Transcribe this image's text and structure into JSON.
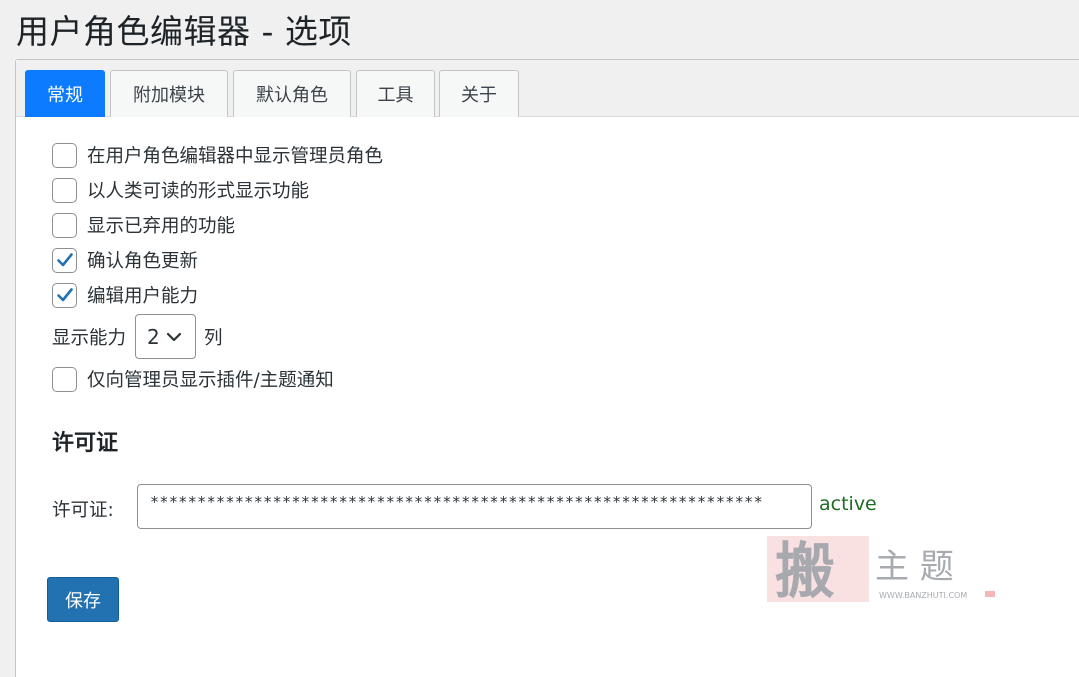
{
  "page": {
    "title": "用户角色编辑器 - 选项"
  },
  "tabs": [
    {
      "label": "常规",
      "active": true
    },
    {
      "label": "附加模块",
      "active": false
    },
    {
      "label": "默认角色",
      "active": false
    },
    {
      "label": "工具",
      "active": false
    },
    {
      "label": "关于",
      "active": false
    }
  ],
  "options": [
    {
      "label": "在用户角色编辑器中显示管理员角色",
      "checked": false
    },
    {
      "label": "以人类可读的形式显示功能",
      "checked": false
    },
    {
      "label": "显示已弃用的功能",
      "checked": false
    },
    {
      "label": "确认角色更新",
      "checked": true
    },
    {
      "label": "编辑用户能力",
      "checked": true
    },
    {
      "label": "仅向管理员显示插件/主题通知",
      "checked": false
    }
  ],
  "columns": {
    "label_before": "显示能力",
    "value": "2",
    "label_after": "列"
  },
  "license": {
    "heading": "许可证",
    "label": "许可证:",
    "value": "*****************************************************************",
    "status": "active"
  },
  "save_label": "保存",
  "watermark": {
    "glyph": "搬",
    "text": "主 题",
    "url": "WWW.BANZHUTI.COM"
  },
  "colors": {
    "accent": "#0d7bff",
    "button": "#2271b1",
    "status": "#1e6b23",
    "check": "#2271b1"
  }
}
